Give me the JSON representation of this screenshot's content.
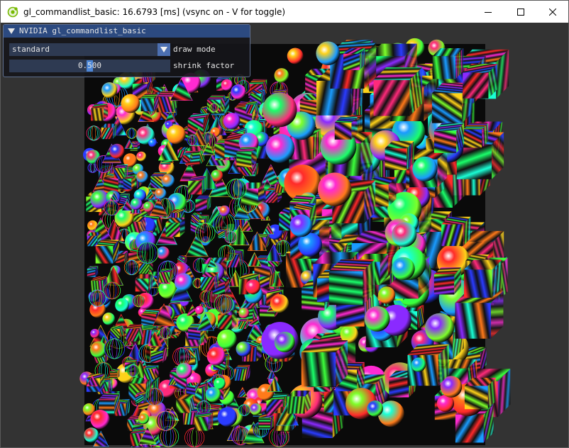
{
  "window": {
    "title": "gl_commandlist_basic: 16.6793 [ms] (vsync on - V for toggle)",
    "app_icon": "nvidia-app-icon",
    "controls": {
      "minimize_icon": "minimize-icon",
      "maximize_icon": "maximize-icon",
      "close_icon": "close-icon"
    }
  },
  "panel": {
    "title": "NVIDIA gl_commandlist_basic",
    "collapse_icon": "triangle-down-icon",
    "draw_mode": {
      "label": "draw mode",
      "value": "standard",
      "dropdown_icon": "triangle-down-icon"
    },
    "shrink_factor": {
      "label": "shrink factor",
      "value_text": "0.500",
      "value": 0.5
    }
  },
  "colors": {
    "background": "#333333",
    "panel_title": "#2c4a80",
    "widget_bg": "#2e3a52",
    "accent": "#4c86d6"
  }
}
